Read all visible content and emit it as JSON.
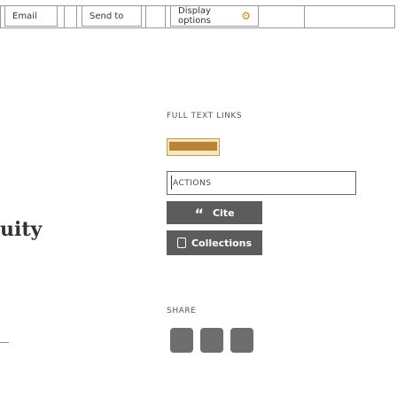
{
  "toolbar": {
    "email_label": "Email",
    "send_to_label": "Send to",
    "display_options_label": "Display options",
    "display_options_icon": "gear-icon"
  },
  "left_panel": {
    "partial_text": "uity"
  },
  "right_panel": {
    "full_text_links_label": "FULL TEXT LINKS",
    "logo_icon": "publisher-logo-icon",
    "actions_label": "ACTIONS",
    "cite": {
      "label": "Cite",
      "icon": "quote-icon"
    },
    "collections": {
      "label": "Collections",
      "icon": "bookmark-icon"
    },
    "share_label": "SHARE",
    "share_icons": [
      "share-icon-1",
      "share-icon-2",
      "share-icon-3"
    ]
  },
  "colors": {
    "button_bg": "#5c5c5c",
    "gear_accent": "#d38a1a",
    "logo_accent": "#b88436"
  }
}
